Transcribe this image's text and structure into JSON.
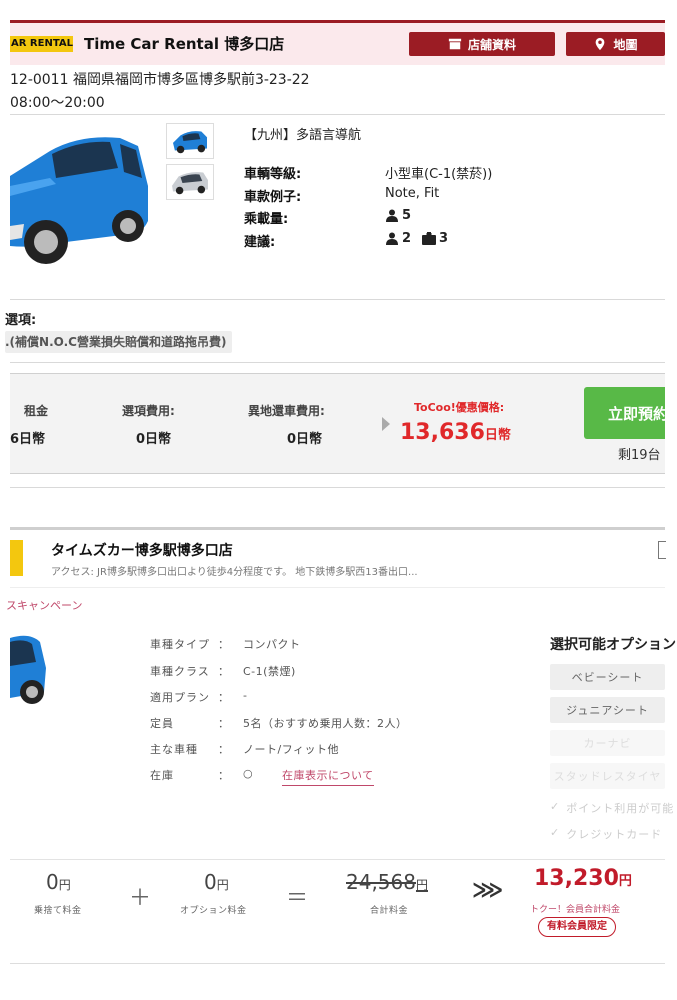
{
  "listing": {
    "brand_logo": "AR RENTAL",
    "store_title": "Time Car Rental 博多口店",
    "buttons": {
      "store_info": "店舗資料",
      "map": "地圖"
    },
    "address": "12-0011 福岡県福岡市博多區博多駅前3-23-22",
    "hours": "08:00～20:00",
    "plan_name": "【九州】多語言導航",
    "specs": [
      {
        "label": "車輌等級:",
        "value": "小型車(C-1(禁菸))"
      },
      {
        "label": "車款例子:",
        "value": "Note, Fit"
      },
      {
        "label": "乘載量:",
        "value": "5"
      },
      {
        "label": "建議:",
        "people": "2",
        "bags": "3"
      }
    ],
    "options_title": "選項:",
    "options_chip": ".(補償N.O.C營業損失賠償和道路拖吊費)",
    "prices": {
      "rent_label": "租金",
      "rent_value": "6日幣",
      "option_label": "選項費用:",
      "option_value": "0日幣",
      "dropoff_label": "異地還車費用:",
      "dropoff_value": "0日幣",
      "tocoo_label": "ToCoo!優惠價格:",
      "tocoo_amount": "13,636",
      "tocoo_unit": "日幣"
    },
    "book_button": "立即預約",
    "remaining": "剩19台"
  },
  "offer": {
    "store": "タイムズカー博多駅博多口店",
    "access": "アクセス: JR博多駅博多口出口より徒歩4分程度です。 地下鉄博多駅西13番出口...",
    "campaign": "スキャンペーン",
    "rows": [
      {
        "label": "車種タイプ",
        "value": "コンパクト"
      },
      {
        "label": "車種クラス",
        "value": "C-1(禁煙)"
      },
      {
        "label": "適用プラン",
        "value": "-"
      },
      {
        "label": "定員",
        "value": "5名（おすすめ乗用人数：2人）"
      },
      {
        "label": "主な車種",
        "value": "ノート/フィット他"
      },
      {
        "label": "在庫",
        "value": "○"
      }
    ],
    "colon": "：",
    "stock_link": "在庫表示について",
    "options_heading": "選択可能オプション",
    "option_buttons": [
      "ベビーシート",
      "ジュニアシート",
      "カーナビ",
      "スタッドレスタイヤ"
    ],
    "checks": [
      "ポイント利用が可能",
      "クレジットカード"
    ],
    "calc": {
      "drop_amount": "0",
      "drop_unit": "円",
      "drop_caption": "乗捨て料金",
      "plus": "＋",
      "option_amount": "0",
      "option_unit": "円",
      "option_caption": "オプション料金",
      "equals": "＝",
      "total_amount": "24,568",
      "total_unit": "円",
      "total_caption": "合計料金",
      "arrows": "⋙",
      "final_amount": "13,230",
      "final_unit": "円",
      "final_caption": "トクー！会員合計料金",
      "member_badge": "有料会員限定"
    }
  },
  "colors": {
    "brand_red": "#9b1c24",
    "price_red": "#e0282a",
    "book_green": "#58b947",
    "logo_yellow": "#f3c70f"
  },
  "icons": [
    "store-icon",
    "map-pin-icon",
    "person-icon",
    "luggage-icon",
    "play-arrow-icon",
    "check-icon"
  ]
}
